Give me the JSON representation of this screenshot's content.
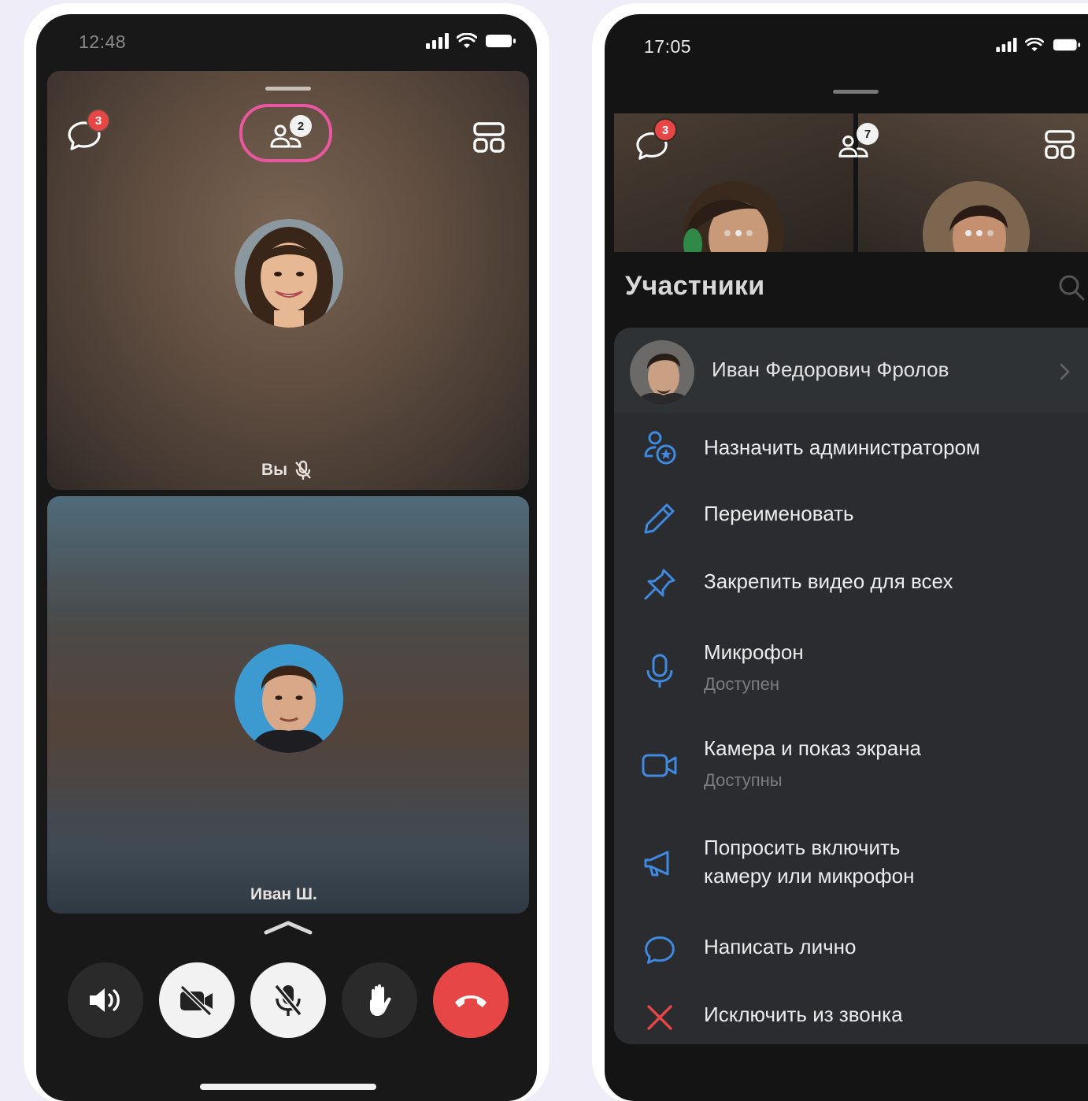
{
  "left_screen": {
    "status_time": "12:48",
    "chat_unread_count": "3",
    "participants_count": "2",
    "self_tile": {
      "label": "Вы"
    },
    "other_tile": {
      "label": "Иван Ш."
    },
    "controls": [
      "speaker",
      "camera-off",
      "mic-off",
      "raise-hand",
      "end-call"
    ]
  },
  "right_screen": {
    "status_time": "17:05",
    "chat_unread_count": "3",
    "participants_count": "7",
    "section_title": "Участники",
    "participant": {
      "name": "Иван Федорович Фролов"
    },
    "menu": {
      "make_admin": {
        "label": "Назначить администратором",
        "icon": "user-star-icon"
      },
      "rename": {
        "label": "Переименовать",
        "icon": "pencil-icon"
      },
      "pin_video": {
        "label": "Закрепить видео для всех",
        "icon": "pin-icon"
      },
      "microphone": {
        "label": "Микрофон",
        "status": "Доступен",
        "icon": "microphone-icon"
      },
      "camera_screen": {
        "label": "Камера и показ экрана",
        "status": "Доступны",
        "icon": "camera-icon"
      },
      "ask_enable": {
        "label_line1": "Попросить включить",
        "label_line2": "камеру или микрофон",
        "icon": "megaphone-icon"
      },
      "message": {
        "label": "Написать лично",
        "icon": "chat-bubble-icon"
      },
      "kick": {
        "label": "Исключить из звонка",
        "icon": "close-icon"
      }
    }
  },
  "colors": {
    "accent_blue": "#3f8ae0",
    "danger_red": "#e64646",
    "highlight_pink": "#e8579f"
  }
}
